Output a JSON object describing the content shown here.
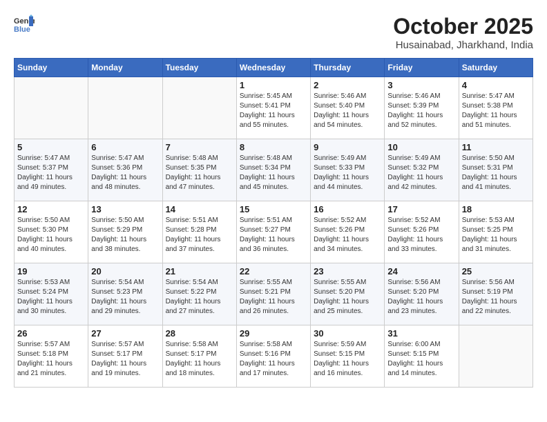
{
  "logo": {
    "text_general": "General",
    "text_blue": "Blue"
  },
  "header": {
    "month": "October 2025",
    "location": "Husainabad, Jharkhand, India"
  },
  "weekdays": [
    "Sunday",
    "Monday",
    "Tuesday",
    "Wednesday",
    "Thursday",
    "Friday",
    "Saturday"
  ],
  "weeks": [
    [
      {
        "day": "",
        "info": ""
      },
      {
        "day": "",
        "info": ""
      },
      {
        "day": "",
        "info": ""
      },
      {
        "day": "1",
        "info": "Sunrise: 5:45 AM\nSunset: 5:41 PM\nDaylight: 11 hours and 55 minutes."
      },
      {
        "day": "2",
        "info": "Sunrise: 5:46 AM\nSunset: 5:40 PM\nDaylight: 11 hours and 54 minutes."
      },
      {
        "day": "3",
        "info": "Sunrise: 5:46 AM\nSunset: 5:39 PM\nDaylight: 11 hours and 52 minutes."
      },
      {
        "day": "4",
        "info": "Sunrise: 5:47 AM\nSunset: 5:38 PM\nDaylight: 11 hours and 51 minutes."
      }
    ],
    [
      {
        "day": "5",
        "info": "Sunrise: 5:47 AM\nSunset: 5:37 PM\nDaylight: 11 hours and 49 minutes."
      },
      {
        "day": "6",
        "info": "Sunrise: 5:47 AM\nSunset: 5:36 PM\nDaylight: 11 hours and 48 minutes."
      },
      {
        "day": "7",
        "info": "Sunrise: 5:48 AM\nSunset: 5:35 PM\nDaylight: 11 hours and 47 minutes."
      },
      {
        "day": "8",
        "info": "Sunrise: 5:48 AM\nSunset: 5:34 PM\nDaylight: 11 hours and 45 minutes."
      },
      {
        "day": "9",
        "info": "Sunrise: 5:49 AM\nSunset: 5:33 PM\nDaylight: 11 hours and 44 minutes."
      },
      {
        "day": "10",
        "info": "Sunrise: 5:49 AM\nSunset: 5:32 PM\nDaylight: 11 hours and 42 minutes."
      },
      {
        "day": "11",
        "info": "Sunrise: 5:50 AM\nSunset: 5:31 PM\nDaylight: 11 hours and 41 minutes."
      }
    ],
    [
      {
        "day": "12",
        "info": "Sunrise: 5:50 AM\nSunset: 5:30 PM\nDaylight: 11 hours and 40 minutes."
      },
      {
        "day": "13",
        "info": "Sunrise: 5:50 AM\nSunset: 5:29 PM\nDaylight: 11 hours and 38 minutes."
      },
      {
        "day": "14",
        "info": "Sunrise: 5:51 AM\nSunset: 5:28 PM\nDaylight: 11 hours and 37 minutes."
      },
      {
        "day": "15",
        "info": "Sunrise: 5:51 AM\nSunset: 5:27 PM\nDaylight: 11 hours and 36 minutes."
      },
      {
        "day": "16",
        "info": "Sunrise: 5:52 AM\nSunset: 5:26 PM\nDaylight: 11 hours and 34 minutes."
      },
      {
        "day": "17",
        "info": "Sunrise: 5:52 AM\nSunset: 5:26 PM\nDaylight: 11 hours and 33 minutes."
      },
      {
        "day": "18",
        "info": "Sunrise: 5:53 AM\nSunset: 5:25 PM\nDaylight: 11 hours and 31 minutes."
      }
    ],
    [
      {
        "day": "19",
        "info": "Sunrise: 5:53 AM\nSunset: 5:24 PM\nDaylight: 11 hours and 30 minutes."
      },
      {
        "day": "20",
        "info": "Sunrise: 5:54 AM\nSunset: 5:23 PM\nDaylight: 11 hours and 29 minutes."
      },
      {
        "day": "21",
        "info": "Sunrise: 5:54 AM\nSunset: 5:22 PM\nDaylight: 11 hours and 27 minutes."
      },
      {
        "day": "22",
        "info": "Sunrise: 5:55 AM\nSunset: 5:21 PM\nDaylight: 11 hours and 26 minutes."
      },
      {
        "day": "23",
        "info": "Sunrise: 5:55 AM\nSunset: 5:20 PM\nDaylight: 11 hours and 25 minutes."
      },
      {
        "day": "24",
        "info": "Sunrise: 5:56 AM\nSunset: 5:20 PM\nDaylight: 11 hours and 23 minutes."
      },
      {
        "day": "25",
        "info": "Sunrise: 5:56 AM\nSunset: 5:19 PM\nDaylight: 11 hours and 22 minutes."
      }
    ],
    [
      {
        "day": "26",
        "info": "Sunrise: 5:57 AM\nSunset: 5:18 PM\nDaylight: 11 hours and 21 minutes."
      },
      {
        "day": "27",
        "info": "Sunrise: 5:57 AM\nSunset: 5:17 PM\nDaylight: 11 hours and 19 minutes."
      },
      {
        "day": "28",
        "info": "Sunrise: 5:58 AM\nSunset: 5:17 PM\nDaylight: 11 hours and 18 minutes."
      },
      {
        "day": "29",
        "info": "Sunrise: 5:58 AM\nSunset: 5:16 PM\nDaylight: 11 hours and 17 minutes."
      },
      {
        "day": "30",
        "info": "Sunrise: 5:59 AM\nSunset: 5:15 PM\nDaylight: 11 hours and 16 minutes."
      },
      {
        "day": "31",
        "info": "Sunrise: 6:00 AM\nSunset: 5:15 PM\nDaylight: 11 hours and 14 minutes."
      },
      {
        "day": "",
        "info": ""
      }
    ]
  ]
}
